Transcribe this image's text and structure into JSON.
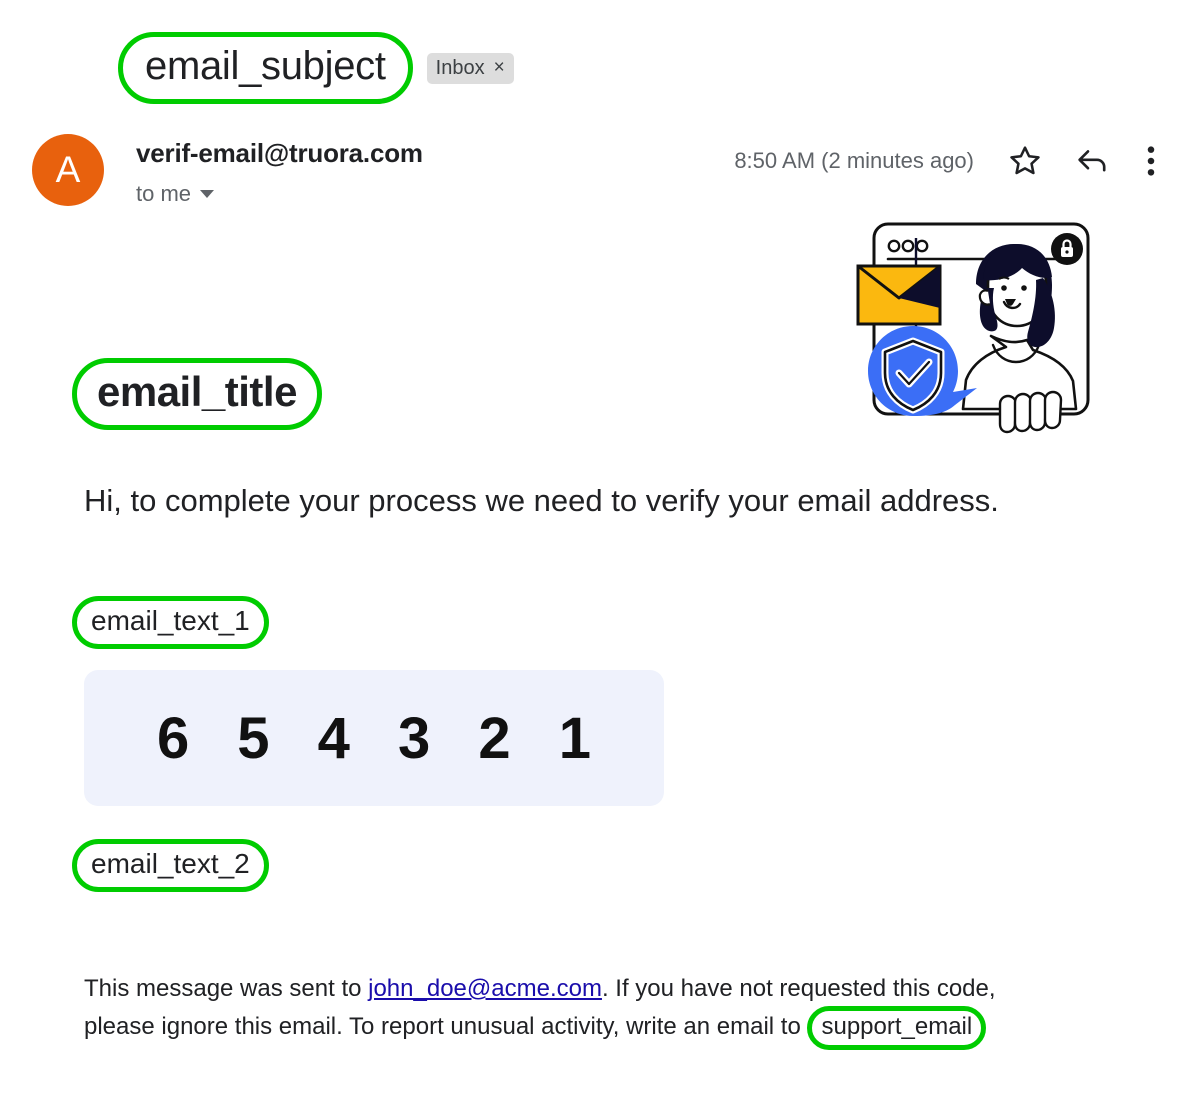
{
  "mail": {
    "subject": "email_subject",
    "label_chip": {
      "text": "Inbox",
      "close_glyph": "×"
    },
    "sender": {
      "avatar_letter": "A",
      "address": "verif-email@truora.com",
      "recipient": "to me"
    },
    "timestamp": "8:50 AM (2 minutes ago)",
    "actions": {
      "star": "star-icon",
      "reply": "reply-icon",
      "more": "more-vert-icon"
    }
  },
  "body": {
    "title": "email_title",
    "greeting": "Hi, to complete your process we need to verify your email address.",
    "text_1": "email_text_1",
    "verification_code": "6 5 4 3 2 1",
    "text_2": "email_text_2",
    "footer": {
      "part_1": "This message was sent to ",
      "recipient_link": "john_doe@acme.com",
      "part_2": ".  If you have not requested this code, please ignore this email. To report unusual activity, write an email to ",
      "support_placeholder": "support_email"
    }
  },
  "illustration": {
    "name": "email-verification-illustration",
    "browser_dots": 3,
    "lock_badge": "lock-icon",
    "envelope": "envelope-icon",
    "shield": "shield-check-icon",
    "person": "woman-illustration"
  },
  "colors": {
    "annotation_green": "#00cc00",
    "avatar_orange": "#e8610d",
    "chip_gray": "#dddddd",
    "code_box_bg": "#eff2fc",
    "link_blue": "#1a0dab",
    "illustration_blue": "#3b6ef6",
    "illustration_yellow": "#fbb80f",
    "illustration_navy": "#0d0d2b"
  }
}
